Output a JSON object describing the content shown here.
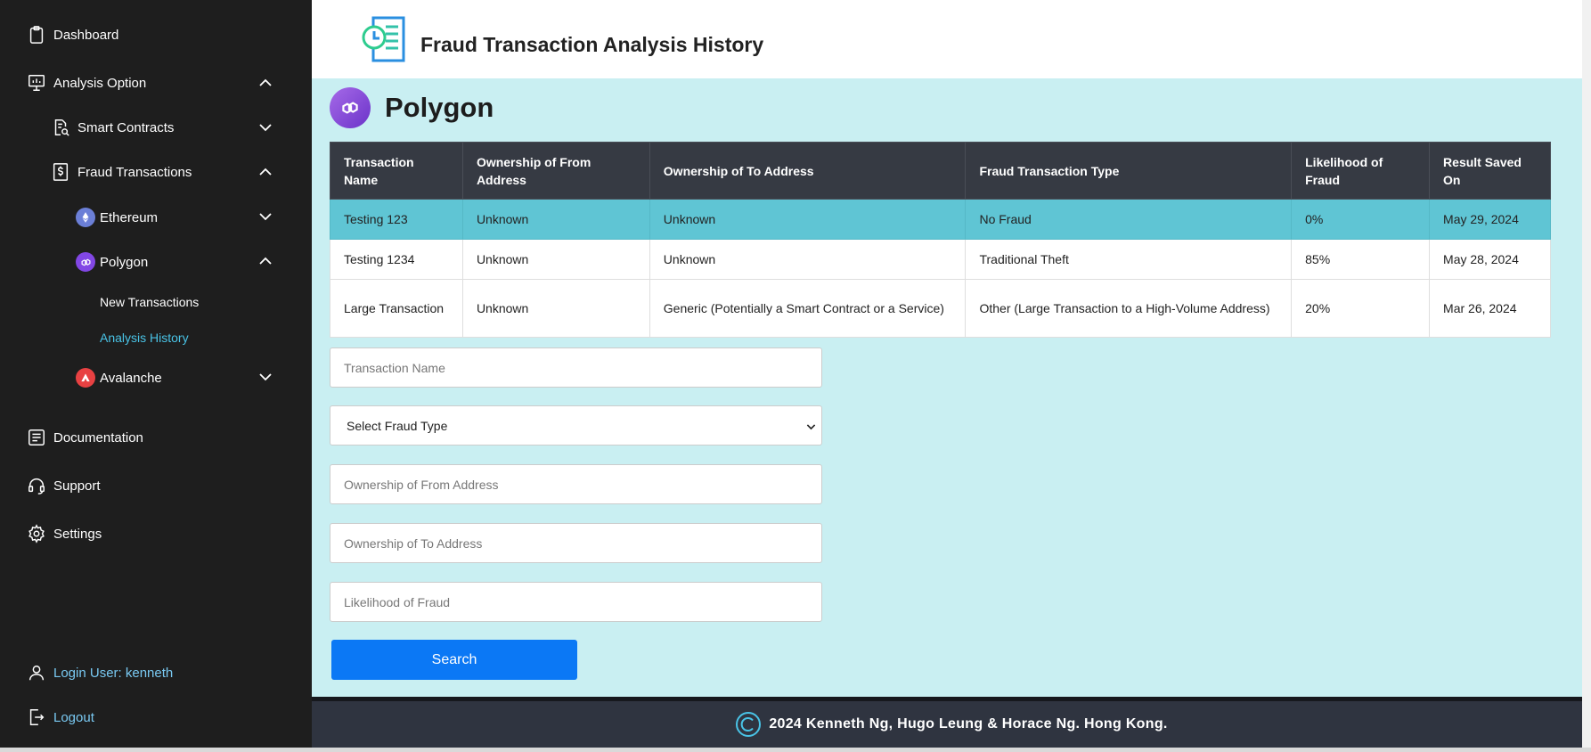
{
  "sidebar": {
    "dashboard": "Dashboard",
    "analysis_option": "Analysis Option",
    "smart_contracts": "Smart Contracts",
    "fraud_transactions": "Fraud Transactions",
    "ethereum": "Ethereum",
    "polygon": "Polygon",
    "new_transactions": "New Transactions",
    "analysis_history": "Analysis History",
    "avalanche": "Avalanche",
    "documentation": "Documentation",
    "support": "Support",
    "settings": "Settings",
    "login_user": "Login User: kenneth",
    "logout": "Logout"
  },
  "header": {
    "title": "Fraud Transaction Analysis History"
  },
  "chain": {
    "name": "Polygon"
  },
  "table": {
    "headers": [
      "Transaction Name",
      "Ownership of From Address",
      "Ownership of To Address",
      "Fraud Transaction Type",
      "Likelihood of Fraud",
      "Result Saved On"
    ],
    "rows": [
      [
        "Testing 123",
        "Unknown",
        "Unknown",
        "No Fraud",
        "0%",
        "May 29, 2024"
      ],
      [
        "Testing 1234",
        "Unknown",
        "Unknown",
        "Traditional Theft",
        "85%",
        "May 28, 2024"
      ],
      [
        "Large Transaction",
        "Unknown",
        "Generic (Potentially a Smart Contract or a Service)",
        "Other (Large Transaction to a High-Volume Address)",
        "20%",
        "Mar 26, 2024"
      ]
    ]
  },
  "form": {
    "transaction_name_placeholder": "Transaction Name",
    "fraud_type_selected": "Select Fraud Type",
    "from_placeholder": "Ownership of From Address",
    "to_placeholder": "Ownership of To Address",
    "likelihood_placeholder": "Likelihood of Fraud",
    "search_label": "Search"
  },
  "footer": {
    "text": "2024 Kenneth Ng, Hugo Leung & Horace Ng. Hong Kong."
  },
  "colors": {
    "sidebar_bg": "#1e1e1e",
    "content_bg": "#c9eff2",
    "highlight_row": "#5fc5d4",
    "button": "#0b78f5",
    "active_link": "#49c3e6"
  }
}
